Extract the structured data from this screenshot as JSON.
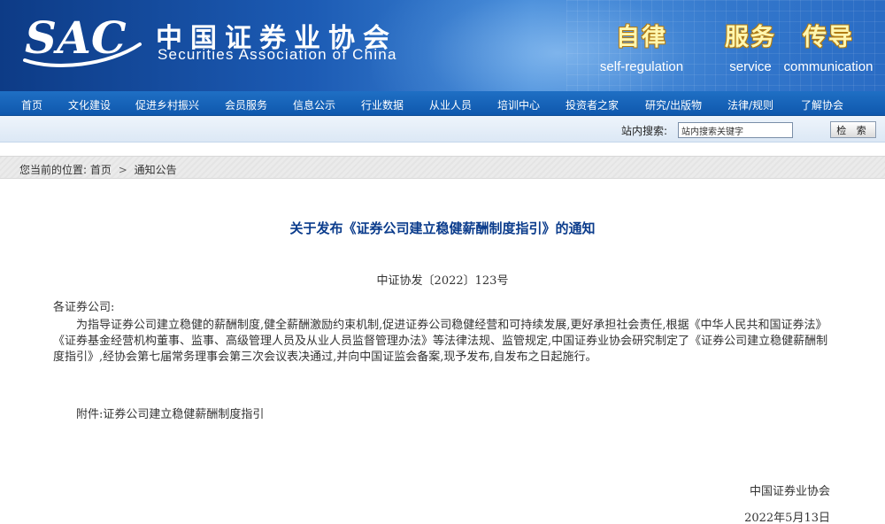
{
  "header": {
    "logo_text": "SAC",
    "org_name_cn": "中国证券业协会",
    "org_name_en": "Securities Association of China",
    "slogans": [
      {
        "cn": "自律",
        "en": "self-regulation"
      },
      {
        "cn": "服务",
        "en": "service"
      },
      {
        "cn": "传导",
        "en": "communication"
      }
    ]
  },
  "nav": {
    "items": [
      "首页",
      "文化建设",
      "促进乡村振兴",
      "会员服务",
      "信息公示",
      "行业数据",
      "从业人员",
      "培训中心",
      "投资者之家",
      "研究/出版物",
      "法律/规则",
      "了解协会"
    ]
  },
  "search": {
    "label": "站内搜索:",
    "placeholder": "站内搜索关键字",
    "button_label": "检 索"
  },
  "breadcrumb": {
    "prefix": "您当前的位置:",
    "home": "首页",
    "separator": ">",
    "current": "通知公告"
  },
  "article": {
    "title": "关于发布《证券公司建立稳健薪酬制度指引》的通知",
    "doc_number": "中证协发〔2022〕123号",
    "greeting": "各证券公司:",
    "body": "为指导证券公司建立稳健的薪酬制度,健全薪酬激励约束机制,促进证券公司稳健经营和可持续发展,更好承担社会责任,根据《中华人民共和国证券法》《证券基金经营机构董事、监事、高级管理人员及从业人员监督管理办法》等法律法规、监管规定,中国证券业协会研究制定了《证券公司建立稳健薪酬制度指引》,经协会第七届常务理事会第三次会议表决通过,并向中国证监会备案,现予发布,自发布之日起施行。",
    "attachment": "附件:证券公司建立稳健薪酬制度指引",
    "signature_org": "中国证券业协会",
    "signature_date": "2022年5月13日"
  },
  "colors": {
    "banner_primary": "#1c5bb4",
    "nav_bg": "#1463b8",
    "title_color": "#0b3c8c",
    "slogan_fill": "#fff7b0"
  }
}
